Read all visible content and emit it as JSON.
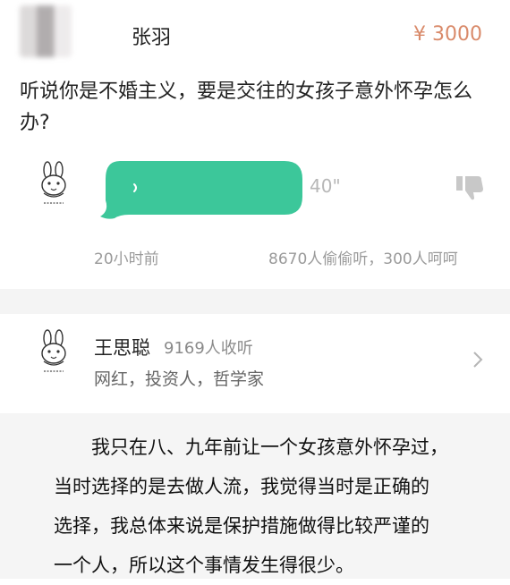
{
  "question_card": {
    "asker_name": "张羽",
    "price": "¥ 3000",
    "question_text": "听说你是不婚主义，要是交往的女孩子意外怀孕怎么办?",
    "voice_duration": "40\"",
    "time_ago": "20小时前",
    "listen_count": "8670人偷偷听，300人呵呵",
    "accent_color": "#3cc79a"
  },
  "answerer": {
    "name": "王思聪",
    "followers": "9169人收听",
    "tags": "网红，投资人，哲学家"
  },
  "quote": {
    "line1": "我只在八、九年前让一个女孩意外怀孕过，",
    "line2": "当时选择的是去做人流，我觉得当时是正确的",
    "line3": "选择，我总体来说是保护措施做得比较严谨的",
    "line4": "一个人，所以这个事情发生得很少。"
  },
  "icons": {
    "asker_avatar": "blurred-avatar",
    "answerer_avatar": "bunny-avatar-icon",
    "dislike": "thumbs-down-icon",
    "chevron": "chevron-right-icon"
  }
}
